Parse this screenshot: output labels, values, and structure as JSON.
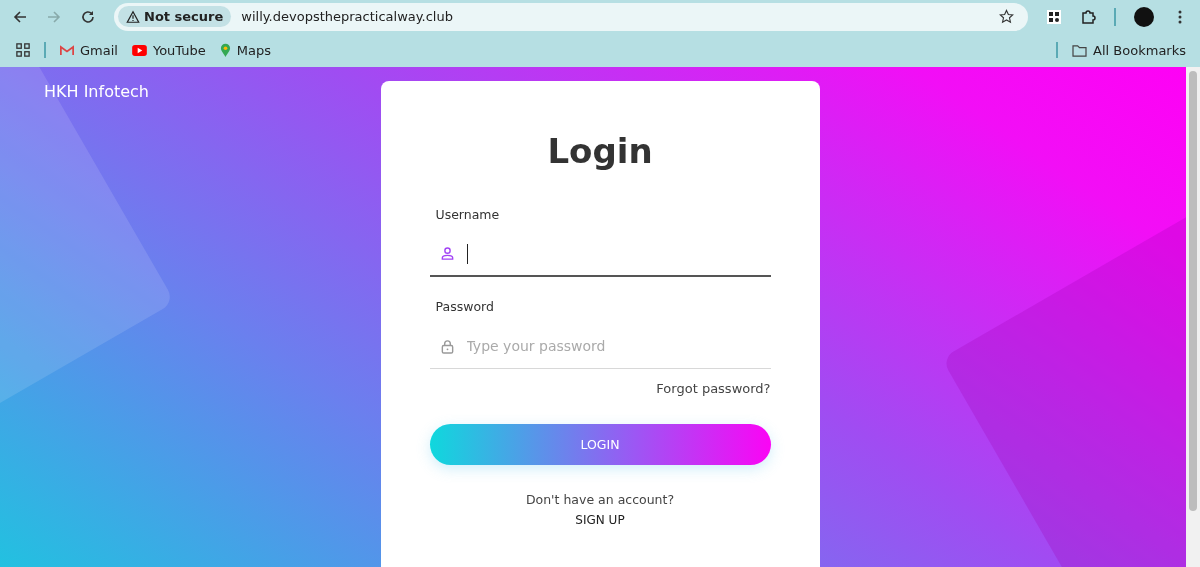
{
  "browser": {
    "security_label": "Not secure",
    "url": "willy.devopsthepracticalway.club",
    "bookmarks": [
      "Gmail",
      "YouTube",
      "Maps"
    ],
    "all_bookmarks": "All Bookmarks"
  },
  "page": {
    "brand": "HKH Infotech",
    "title": "Login",
    "fields": [
      {
        "kind": "user",
        "label": "Username",
        "focused": true
      },
      {
        "kind": "lock",
        "label": "Password",
        "placeholder": "Type your password",
        "focused": false
      }
    ],
    "forgot_link": "Forgot password?",
    "login_button": "LOGIN",
    "signup_prompt": "Don't have an account?",
    "signup_link": "SIGN UP"
  }
}
